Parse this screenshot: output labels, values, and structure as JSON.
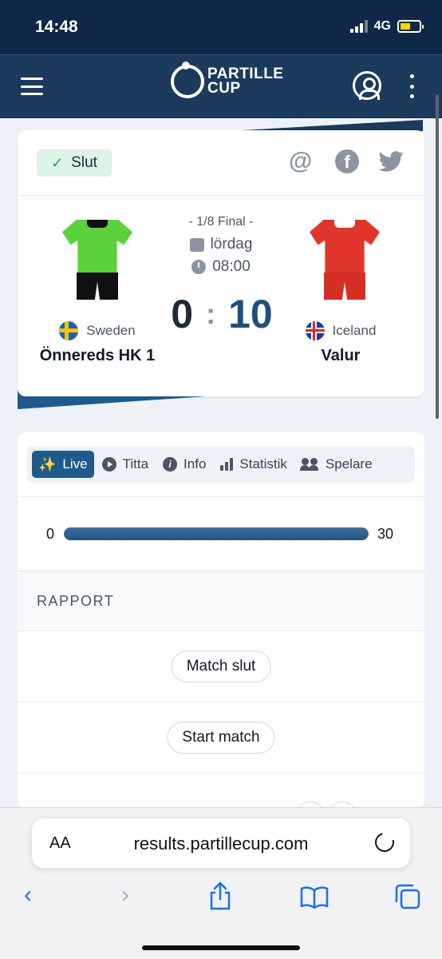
{
  "status_bar": {
    "time": "14:48",
    "network": "4G"
  },
  "app": {
    "logo_line1": "PARTILLE",
    "logo_line2": "CUP",
    "menu_icon": "hamburger-icon",
    "account_icon": "user-circle-icon",
    "more_icon": "kebab-icon"
  },
  "match": {
    "status": "Slut",
    "share_icons": [
      "at-icon",
      "facebook-icon",
      "twitter-icon"
    ],
    "round": "- 1/8 Final -",
    "day": "lördag",
    "time": "08:00",
    "home": {
      "country": "Sweden",
      "team": "Önnereds HK 1",
      "score": "0",
      "kit_color": "#5bd23b"
    },
    "separator": ":",
    "away": {
      "country": "Iceland",
      "team": "Valur",
      "score": "10",
      "kit_color": "#e0352b"
    }
  },
  "tabs": [
    {
      "label": "Live",
      "icon": "sparkle-icon",
      "active": true
    },
    {
      "label": "Titta",
      "icon": "play-icon",
      "active": false
    },
    {
      "label": "Info",
      "icon": "info-icon",
      "active": false
    },
    {
      "label": "Statistik",
      "icon": "bar-chart-icon",
      "active": false
    },
    {
      "label": "Spelare",
      "icon": "people-icon",
      "active": false
    }
  ],
  "progress": {
    "min": "0",
    "max": "30",
    "fraction": 1.0
  },
  "rapport": {
    "heading": "RAPPORT",
    "events": [
      "Match slut",
      "Start match"
    ]
  },
  "browser": {
    "aa_label": "AA",
    "url": "results.partillecup.com",
    "toolbar_icons": [
      "back-icon",
      "forward-icon",
      "share-icon",
      "bookmarks-icon",
      "tabs-icon"
    ]
  },
  "colors": {
    "brand_dark": "#1b3a5c",
    "accent": "#1f5a8c",
    "success_bg": "#dcf3e6"
  }
}
